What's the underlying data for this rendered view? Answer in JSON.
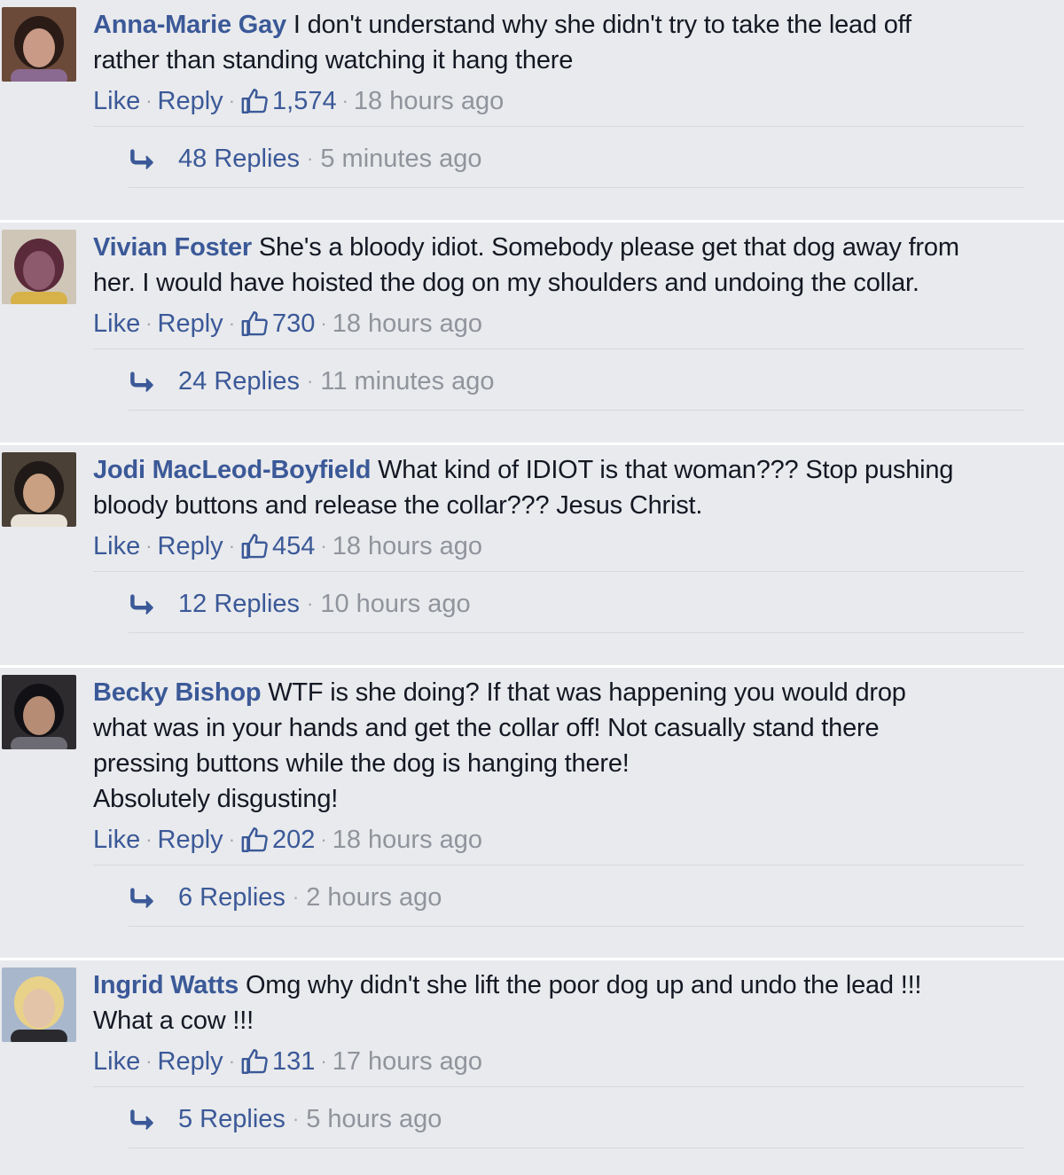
{
  "comments": [
    {
      "author": "Anna-Marie Gay",
      "text": "I don't understand why she didn't try to take the lead off\nrather than standing watching it hang there",
      "like_label": "Like",
      "reply_label": "Reply",
      "likes": "1,574",
      "time": "18 hours ago",
      "replies_label": "48 Replies",
      "replies_time": "5 minutes ago",
      "avatar": {
        "bg": "#6b4a3a",
        "face": "#c99a86",
        "hair": "#2a1b16",
        "accent": "#8a6a90"
      }
    },
    {
      "author": "Vivian Foster",
      "text": "She's a bloody idiot. Somebody please get that dog away from\nher. I would have hoisted the dog on my shoulders and undoing the collar.",
      "like_label": "Like",
      "reply_label": "Reply",
      "likes": "730",
      "time": "18 hours ago",
      "replies_label": "24 Replies",
      "replies_time": "11 minutes ago",
      "avatar": {
        "bg": "#cfc6b8",
        "face": "#8c5a6c",
        "hair": "#5a2a3a",
        "accent": "#d7b24a"
      }
    },
    {
      "author": "Jodi MacLeod-Boyfield",
      "text": "What kind of IDIOT is that woman??? Stop pushing\nbloody buttons and release the collar??? Jesus Christ.",
      "like_label": "Like",
      "reply_label": "Reply",
      "likes": "454",
      "time": "18 hours ago",
      "replies_label": "12 Replies",
      "replies_time": "10 hours ago",
      "avatar": {
        "bg": "#4a4036",
        "face": "#c9a082",
        "hair": "#1f1a17",
        "accent": "#e8e2d8"
      }
    },
    {
      "author": "Becky Bishop",
      "text": "WTF is she doing? If that was happening you would drop\nwhat was in your hands and get the collar off! Not casually stand there\npressing buttons while the dog is hanging there!\nAbsolutely disgusting!",
      "like_label": "Like",
      "reply_label": "Reply",
      "likes": "202",
      "time": "18 hours ago",
      "replies_label": "6 Replies",
      "replies_time": "2 hours ago",
      "avatar": {
        "bg": "#2d2b2e",
        "face": "#b68c74",
        "hair": "#111014",
        "accent": "#6c6a72"
      }
    },
    {
      "author": "Ingrid Watts",
      "text": "Omg why didn't she lift the poor dog up and undo the lead !!!\nWhat a cow !!!",
      "like_label": "Like",
      "reply_label": "Reply",
      "likes": "131",
      "time": "17 hours ago",
      "replies_label": "5 Replies",
      "replies_time": "5 hours ago",
      "avatar": {
        "bg": "#a8b7cc",
        "face": "#e3c4a8",
        "hair": "#e8d28a",
        "accent": "#2a2a2e"
      }
    }
  ],
  "colors": {
    "background": "#e9eaed",
    "author": "#3b5998",
    "link": "#3b5998",
    "meta": "#90949c",
    "text": "#141823"
  },
  "icons": {
    "like": "thumbs-up-icon",
    "reply": "reply-arrow-icon"
  }
}
